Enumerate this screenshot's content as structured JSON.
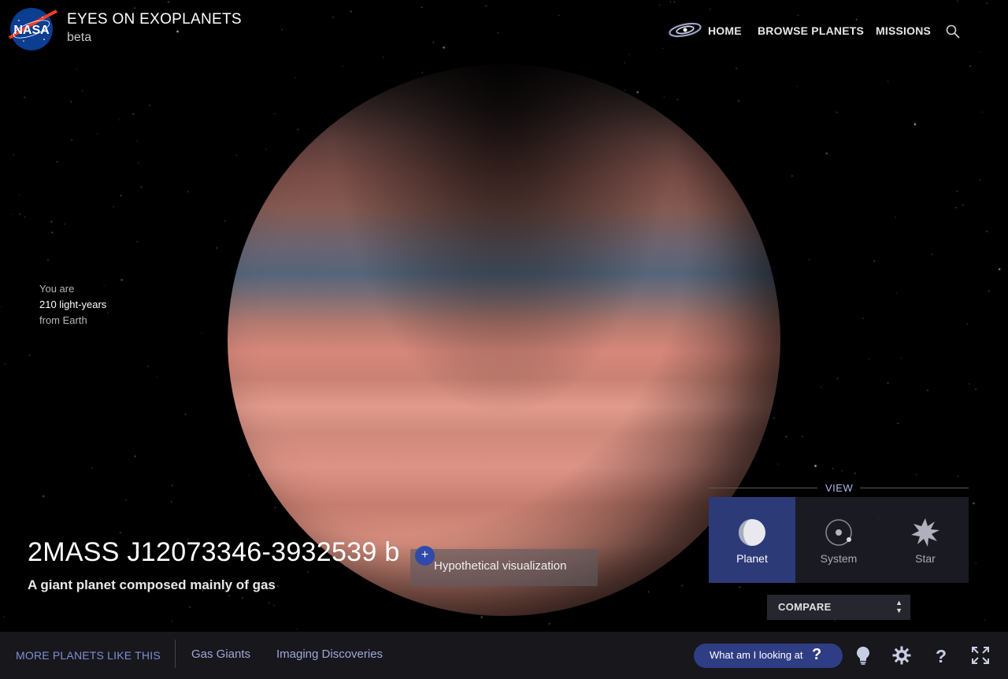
{
  "header": {
    "logo_text": "NASA",
    "app_title": "EYES ON EXOPLANETS",
    "app_subtitle": "beta",
    "nav": [
      {
        "label": "HOME",
        "icon": "galaxy-icon"
      },
      {
        "label": "BROWSE PLANETS"
      },
      {
        "label": "MISSIONS"
      }
    ],
    "search_icon": "search-icon"
  },
  "distance": {
    "line1": "You are",
    "value": "210 light-years",
    "line3": "from Earth"
  },
  "planet": {
    "name": "2MASS J12073346-3932539 b",
    "description": "A giant planet composed mainly of gas",
    "visualization_note": "Hypothetical visualization",
    "expand_symbol": "+"
  },
  "view_panel": {
    "heading": "VIEW",
    "options": [
      {
        "label": "Planet",
        "icon": "planet-icon",
        "active": true
      },
      {
        "label": "System",
        "icon": "system-icon",
        "active": false
      },
      {
        "label": "Star",
        "icon": "star-icon",
        "active": false
      }
    ],
    "compare_label": "COMPARE"
  },
  "bottom_bar": {
    "more_label": "MORE PLANETS LIKE THIS",
    "categories": [
      "Gas Giants",
      "Imaging Discoveries"
    ],
    "what_label": "What am I looking at",
    "what_symbol": "?",
    "tools": [
      "lightbulb-icon",
      "gear-icon",
      "help-icon",
      "fullscreen-icon"
    ]
  },
  "colors": {
    "accent": "#2f3d85",
    "active_view": "#2c3a78",
    "link": "#9fa8d8"
  }
}
